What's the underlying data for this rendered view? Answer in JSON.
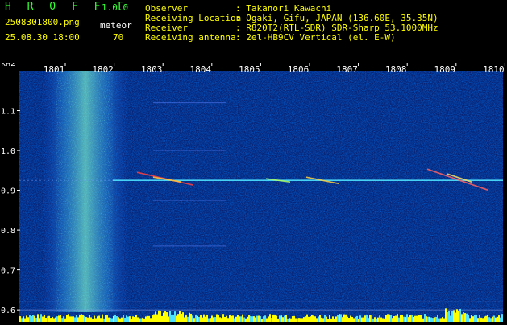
{
  "header": {
    "app_title": "H R O F F T",
    "version": "1.0.0",
    "filename": "2508301800.png",
    "datetime": "25.08.30 18:00",
    "counter_label": "meteor",
    "counter_value": "70",
    "info": [
      {
        "key": "Observer",
        "value": ": Takanori Kawachi"
      },
      {
        "key": "Receiving Location",
        "value": ": Ogaki, Gifu, JAPAN (136.60E, 35.35N)"
      },
      {
        "key": "Receiver",
        "value": ": R820T2(RTL-SDR) SDR-Sharp 53.1000MHz"
      },
      {
        "key": "Receiving antenna",
        "value": ": 2el-HB9CV Vertical (el. E-W)"
      }
    ]
  },
  "colors": {
    "background": "#000000",
    "waterfall_base": "#0a2a8c",
    "accent_green": "#32ff32",
    "accent_yellow": "#ffff00",
    "signal_line": "#40e0ff"
  },
  "chart_data": {
    "type": "heatmap",
    "title": "",
    "x_ticks": [
      "1801",
      "1802",
      "1803",
      "1804",
      "1805",
      "1806",
      "1807",
      "1808",
      "1809",
      "1810"
    ],
    "y_unit_label": "kHz",
    "y_ticks": [
      "1.1",
      "1.0",
      "0.9",
      "0.8",
      "0.7",
      "0.6"
    ],
    "y_range_khz": [
      0.57,
      1.2
    ],
    "carrier_khz": 0.925,
    "broadband_noise_band_x": [
      "1801.5",
      "1802.2"
    ]
  }
}
